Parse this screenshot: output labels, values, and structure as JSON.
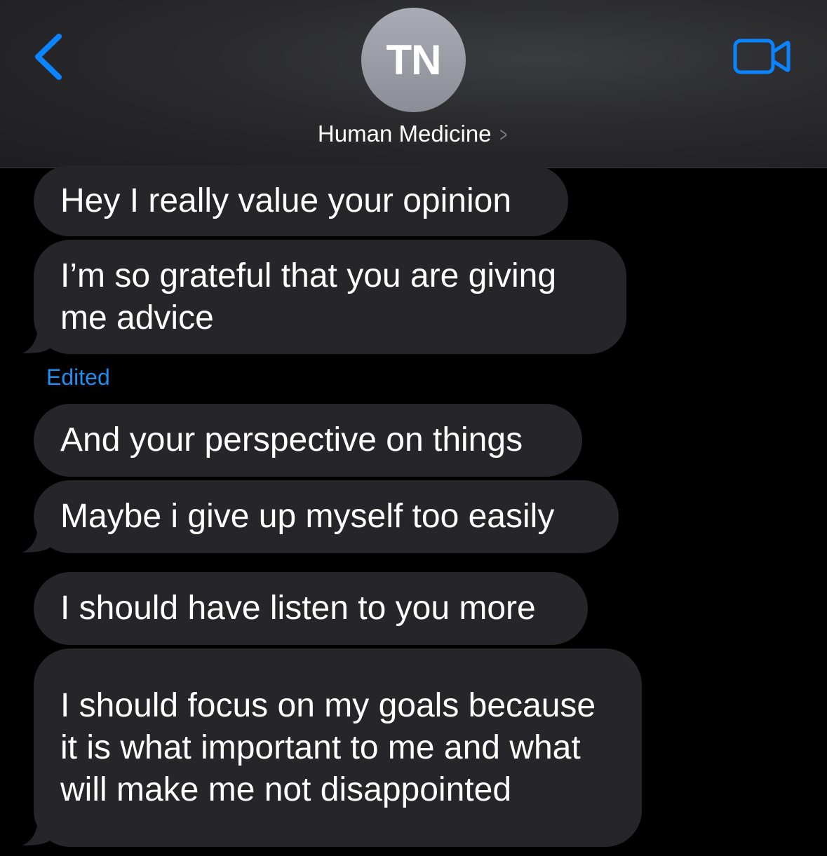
{
  "header": {
    "avatar_initials": "TN",
    "contact_name": "Human Medicine",
    "contact_chevron": ">",
    "accent_color": "#0a84ff",
    "back_icon": "chevron-left-icon",
    "video_icon": "video-camera-icon"
  },
  "messages": [
    {
      "text": "Hey I really value your opinion"
    },
    {
      "text": "I’m so grateful that you are giving me advice"
    },
    {
      "text": "And your perspective on things"
    },
    {
      "text": "Maybe i give up myself too easily"
    },
    {
      "text": "I should have listen to you more"
    },
    {
      "text": "I should focus on my goals because it is what important to me and what will make me not disappointed"
    }
  ],
  "edited_label": "Edited",
  "colors": {
    "background": "#000000",
    "bubble": "#26262a",
    "edited": "#1f8ef1"
  }
}
